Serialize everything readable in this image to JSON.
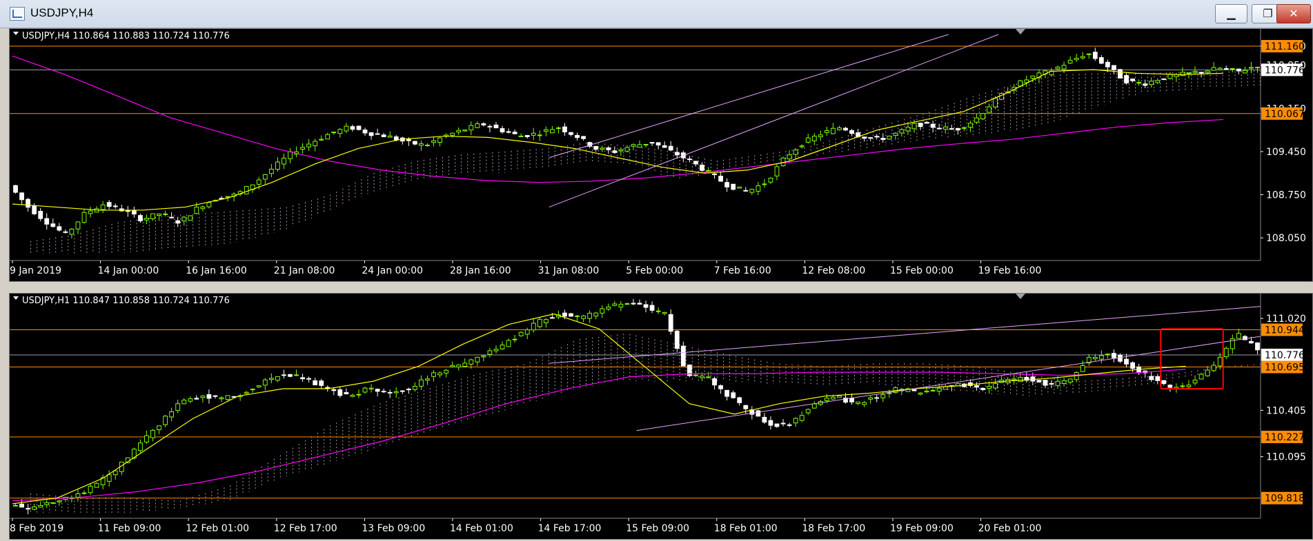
{
  "window": {
    "title": "USDJPY,H4",
    "buttons": {
      "minimize": "▁",
      "maximize": "❐",
      "close": "✕"
    }
  },
  "colors": {
    "background": "#000000",
    "bull": "#7fff00",
    "bear": "#ffffff",
    "ma_fast": "#ffff00",
    "ma_slow": "#ff00ff",
    "cloud": "#f3c7d6",
    "cloud_alt": "#cfd6ff",
    "hline": "#ff8c00",
    "channel": "#e6a6ff",
    "price_label_bg": "#ff8c00",
    "highlight": "#ff0000"
  },
  "chart_data": [
    {
      "type": "candlestick",
      "header": "USDJPY,H4  110.864 110.883 110.724 110.776",
      "ylim": [
        107.75,
        111.35
      ],
      "y_ticks": [
        "111.160",
        "110.850",
        "110.150",
        "109.450",
        "108.750",
        "108.050"
      ],
      "x_ticks": [
        "9 Jan 2019",
        "14 Jan 00:00",
        "16 Jan 16:00",
        "21 Jan 08:00",
        "24 Jan 00:00",
        "28 Jan 16:00",
        "31 Jan 08:00",
        "5 Feb 00:00",
        "7 Feb 16:00",
        "12 Feb 08:00",
        "15 Feb 00:00",
        "19 Feb 16:00"
      ],
      "horizontal_levels": [
        {
          "value": 111.16,
          "label": "111.160",
          "color": "#ff8c00",
          "tag": true
        },
        {
          "value": 110.776,
          "label": "110.776",
          "color": "#9aa0aa",
          "tag": true,
          "current": true
        },
        {
          "value": 110.067,
          "label": "110.067",
          "color": "#ff8c00",
          "tag": true
        }
      ],
      "close_path": [
        108.9,
        108.55,
        108.3,
        108.1,
        108.45,
        108.6,
        108.5,
        108.35,
        108.45,
        108.3,
        108.55,
        108.7,
        108.75,
        108.95,
        109.2,
        109.45,
        109.6,
        109.75,
        109.85,
        109.75,
        109.7,
        109.6,
        109.55,
        109.7,
        109.8,
        109.9,
        109.8,
        109.7,
        109.75,
        109.85,
        109.7,
        109.5,
        109.45,
        109.55,
        109.6,
        109.45,
        109.3,
        109.1,
        108.9,
        108.8,
        108.95,
        109.35,
        109.6,
        109.75,
        109.85,
        109.7,
        109.65,
        109.75,
        109.9,
        109.85,
        109.8,
        109.95,
        110.25,
        110.5,
        110.65,
        110.75,
        110.9,
        111.05,
        110.85,
        110.6,
        110.55,
        110.65,
        110.7,
        110.75,
        110.8,
        110.75,
        110.85
      ],
      "ma_fast": [
        108.6,
        108.55,
        108.5,
        108.5,
        108.55,
        108.7,
        108.95,
        109.25,
        109.5,
        109.65,
        109.7,
        109.68,
        109.6,
        109.5,
        109.35,
        109.2,
        109.1,
        109.15,
        109.3,
        109.55,
        109.8,
        109.95,
        110.1,
        110.4,
        110.75,
        110.78,
        110.72,
        110.7,
        110.72
      ],
      "ma_slow": [
        111.0,
        110.7,
        110.35,
        110.0,
        109.75,
        109.5,
        109.3,
        109.15,
        109.05,
        108.98,
        108.95,
        108.97,
        109.02,
        109.1,
        109.2,
        109.3,
        109.4,
        109.5,
        109.58,
        109.65,
        109.75,
        109.85,
        109.92,
        109.97
      ],
      "cloud_top": [
        108.0,
        108.1,
        108.3,
        108.4,
        108.45,
        108.5,
        108.55,
        108.75,
        109.1,
        109.3,
        109.4,
        109.45,
        109.5,
        109.6,
        109.55,
        109.45,
        109.3,
        109.4,
        109.5,
        109.7,
        109.9,
        110.1,
        110.35,
        110.55,
        110.7,
        110.72,
        110.72,
        110.75,
        110.75,
        110.78
      ],
      "cloud_bottom": [
        107.8,
        107.8,
        107.8,
        107.85,
        107.9,
        108.0,
        108.2,
        108.5,
        108.8,
        109.0,
        109.1,
        109.1,
        109.2,
        109.3,
        109.25,
        109.0,
        109.1,
        109.25,
        109.35,
        109.45,
        109.55,
        109.65,
        109.7,
        109.8,
        109.95,
        110.2,
        110.4,
        110.45,
        110.5,
        110.5
      ]
    },
    {
      "type": "candlestick",
      "header": "USDJPY,H1  110.847 110.858 110.724 110.776",
      "ylim": [
        109.72,
        111.14
      ],
      "y_ticks": [
        "111.020",
        "110.405",
        "110.095"
      ],
      "x_ticks": [
        "8 Feb 2019",
        "11 Feb 09:00",
        "12 Feb 01:00",
        "12 Feb 17:00",
        "13 Feb 09:00",
        "14 Feb 01:00",
        "14 Feb 17:00",
        "15 Feb 09:00",
        "18 Feb 01:00",
        "18 Feb 17:00",
        "19 Feb 09:00",
        "20 Feb 01:00"
      ],
      "horizontal_levels": [
        {
          "value": 110.944,
          "label": "110.944",
          "color": "#ff8c00",
          "tag": true
        },
        {
          "value": 110.776,
          "label": "110.776",
          "color": "#9aa0aa",
          "tag": true,
          "current": true
        },
        {
          "value": 110.695,
          "label": "110.695",
          "color": "#ff8c00",
          "tag": true
        },
        {
          "value": 110.227,
          "label": "110.227",
          "color": "#ff8c00",
          "tag": true
        },
        {
          "value": 109.818,
          "label": "109.818",
          "color": "#ff8c00",
          "tag": true
        }
      ],
      "close_path": [
        109.78,
        109.75,
        109.8,
        109.82,
        109.9,
        110.0,
        110.15,
        110.3,
        110.45,
        110.5,
        110.48,
        110.52,
        110.6,
        110.65,
        110.62,
        110.55,
        110.5,
        110.55,
        110.52,
        110.55,
        110.65,
        110.7,
        110.75,
        110.82,
        110.9,
        111.0,
        111.05,
        111.02,
        111.08,
        111.12,
        111.1,
        111.05,
        110.65,
        110.62,
        110.5,
        110.4,
        110.3,
        110.32,
        110.45,
        110.5,
        110.45,
        110.5,
        110.55,
        110.52,
        110.55,
        110.58,
        110.55,
        110.6,
        110.62,
        110.58,
        110.6,
        110.75,
        110.78,
        110.7,
        110.62,
        110.55,
        110.6,
        110.72,
        110.92,
        110.82
      ],
      "ma_fast": [
        109.78,
        109.82,
        109.95,
        110.15,
        110.35,
        110.5,
        110.55,
        110.55,
        110.6,
        110.7,
        110.85,
        110.98,
        111.05,
        110.95,
        110.7,
        110.45,
        110.38,
        110.45,
        110.5,
        110.52,
        110.55,
        110.57,
        110.6,
        110.62,
        110.65,
        110.68,
        110.7
      ],
      "ma_slow": [
        109.8,
        109.82,
        109.86,
        109.92,
        110.0,
        110.1,
        110.2,
        110.32,
        110.45,
        110.55,
        110.63,
        110.65,
        110.65,
        110.66,
        110.66,
        110.66,
        110.65,
        110.64,
        110.65,
        110.68
      ],
      "cloud_top": [
        109.85,
        109.82,
        109.82,
        109.8,
        109.9,
        110.1,
        110.3,
        110.45,
        110.55,
        110.65,
        110.72,
        110.88,
        110.92,
        110.85,
        110.78,
        110.72,
        110.7,
        110.72,
        110.72,
        110.7,
        110.65,
        110.6,
        110.62,
        110.65,
        110.7,
        110.72
      ],
      "cloud_bottom": [
        109.72,
        109.72,
        109.72,
        109.75,
        109.8,
        109.95,
        110.05,
        110.15,
        110.25,
        110.35,
        110.45,
        110.55,
        110.6,
        110.6,
        110.6,
        110.58,
        110.57,
        110.58,
        110.55,
        110.52,
        110.5,
        110.52,
        110.55,
        110.6,
        110.68,
        110.72
      ],
      "highlight": {
        "from": 0.92,
        "to": 0.97,
        "ymin": 110.55,
        "ymax": 110.95
      }
    }
  ]
}
